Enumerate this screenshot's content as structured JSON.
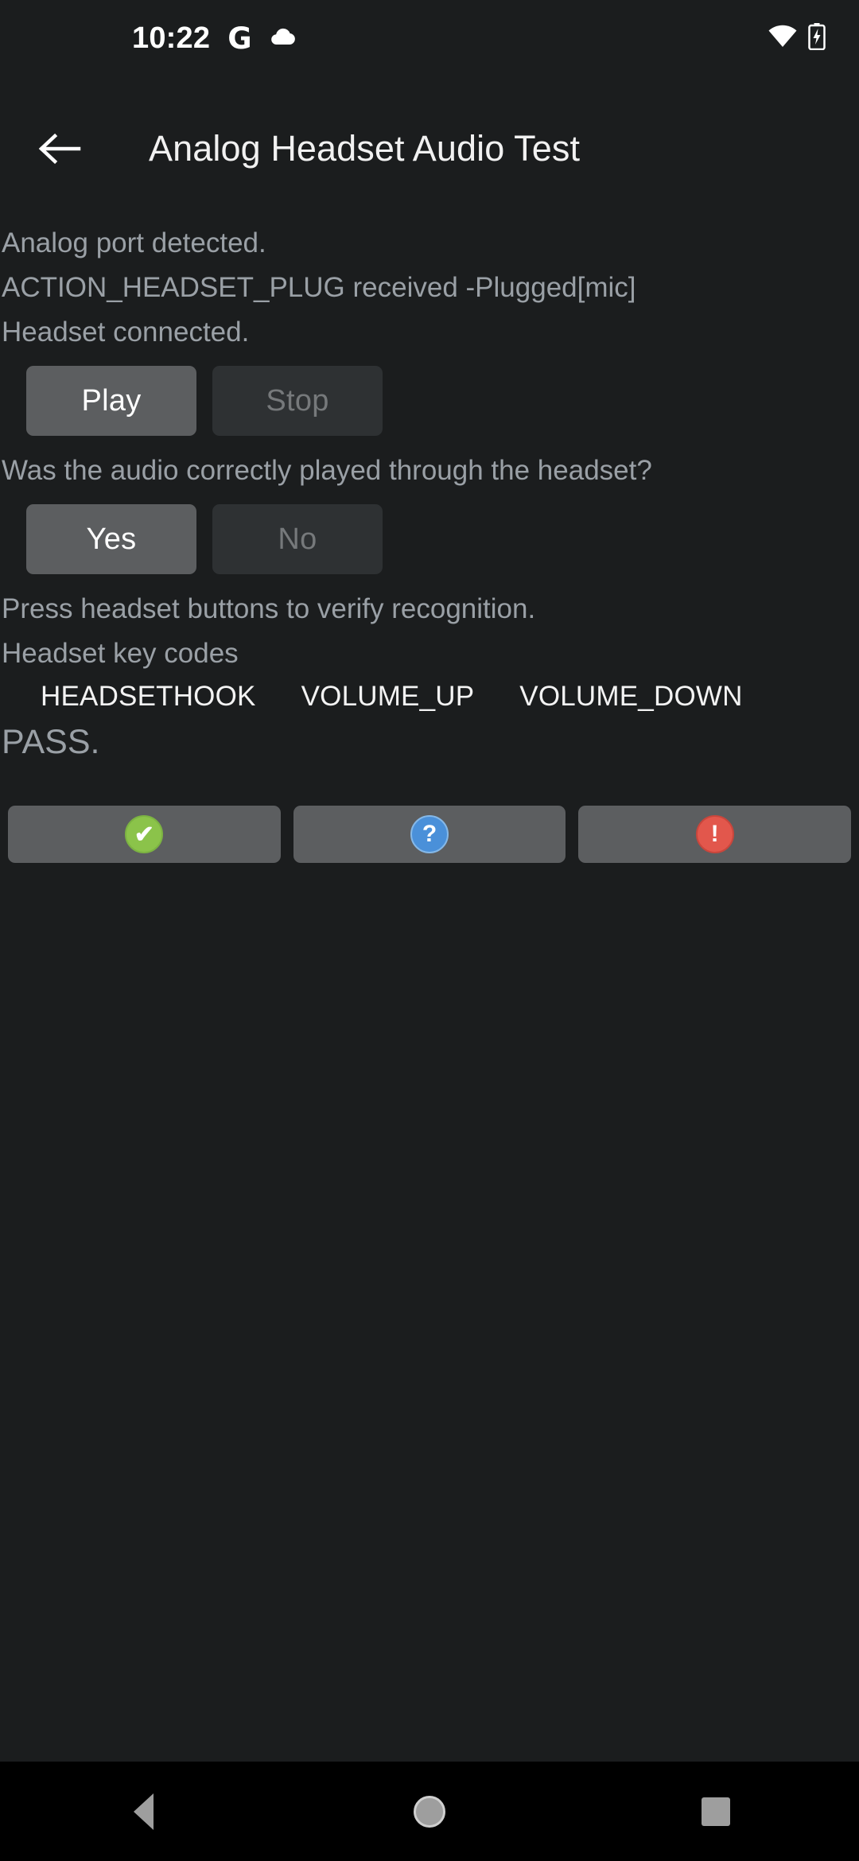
{
  "status_bar": {
    "time": "10:22",
    "google_icon": "G",
    "icons": [
      "google-icon",
      "cloud-icon",
      "wifi-icon",
      "battery-charging-icon"
    ]
  },
  "app_bar": {
    "back_icon": "back-arrow-icon",
    "title": "Analog Headset Audio Test"
  },
  "log": {
    "line1": "Analog port detected.",
    "line2": "ACTION_HEADSET_PLUG received -Plugged[mic]",
    "line3": "Headset connected."
  },
  "playback": {
    "play_label": "Play",
    "stop_label": "Stop",
    "play_enabled": true,
    "stop_enabled": false
  },
  "question": {
    "prompt": "Was the audio correctly played through the headset?",
    "yes_label": "Yes",
    "no_label": "No",
    "yes_enabled": true,
    "no_enabled": false
  },
  "keys": {
    "instruction": "Press headset buttons to verify recognition.",
    "heading": "Headset key codes",
    "codes": [
      "HEADSETHOOK",
      "VOLUME_UP",
      "VOLUME_DOWN"
    ]
  },
  "result": {
    "status": "PASS."
  },
  "verdict_buttons": [
    {
      "name": "pass",
      "glyph": "✔"
    },
    {
      "name": "info",
      "glyph": "?"
    },
    {
      "name": "fail",
      "glyph": "!"
    }
  ],
  "nav_bar": {
    "back": "nav-back-icon",
    "home": "nav-home-icon",
    "recents": "nav-recents-icon"
  },
  "colors": {
    "background": "#1b1d1e",
    "enabled_button": "#5c5e60",
    "disabled_button": "#2e3133",
    "text_secondary": "#9aa0a6",
    "pass_green": "#8bc34a",
    "info_blue": "#4a90d9",
    "fail_red": "#e2574c"
  }
}
